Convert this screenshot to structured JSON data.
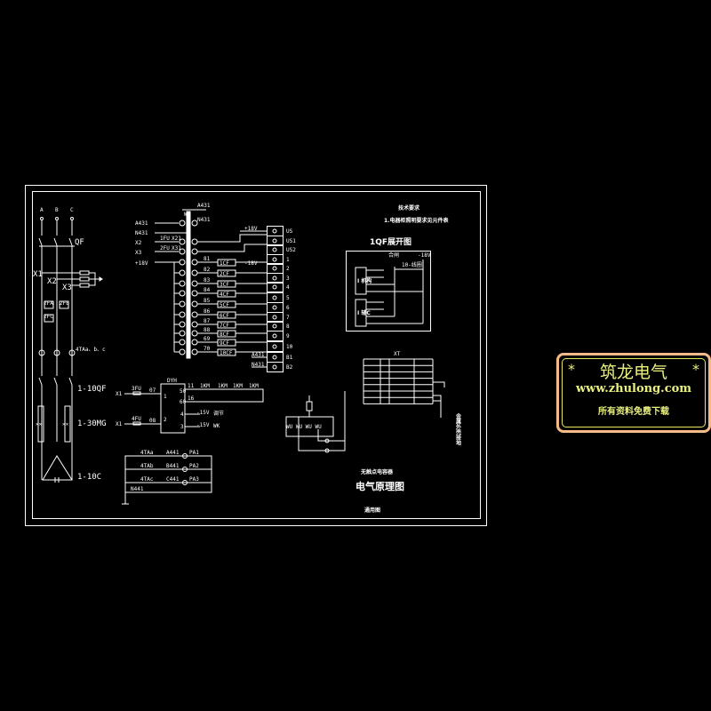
{
  "phases": [
    "A",
    "B",
    "C"
  ],
  "left": {
    "qf": "QF",
    "x1": "X1",
    "x2": "X2",
    "x3": "X3",
    "fa": [
      "2FA",
      "2FB",
      "2FC"
    ],
    "ct": "4TAa、b、c",
    "qf10": "1-10QF",
    "mg": "1-30MG",
    "c10": "1-10C"
  },
  "strip": {
    "top": "A431",
    "wk": "WK",
    "in": [
      "A431",
      "N431",
      "X2",
      "X3",
      "+18V"
    ],
    "n431": "N431",
    "x21": [
      "X21",
      "X31"
    ],
    "fu": [
      "1FU",
      "2FU"
    ],
    "plus18": "+18V",
    "minus18": "-18V",
    "wires": [
      "81",
      "82",
      "83",
      "84",
      "85",
      "86",
      "87",
      "88",
      "69",
      "70"
    ],
    "cf": [
      "1CF",
      "2CF",
      "3CF",
      "4CF",
      "5CF",
      "6CF",
      "7CF",
      "8CF",
      "9CF",
      "10CF"
    ]
  },
  "terminal": {
    "labels": [
      "US",
      "US1",
      "US2",
      "1",
      "2",
      "3",
      "4",
      "5",
      "6",
      "7",
      "8",
      "9",
      "10",
      "B1",
      "B2"
    ],
    "a431": "A431",
    "n431": "N431"
  },
  "dyh": {
    "title": "DYH",
    "x1": "X1",
    "fu3": "3FU",
    "fu4": "4FU",
    "w07": "07",
    "w08": "08",
    "p1": "1",
    "p2": "2",
    "p50": "50",
    "p60": "60",
    "p4": "4",
    "p3": "3",
    "n11": "11",
    "n16": "16",
    "m15a": "-15V",
    "m15b": "-15V",
    "wk": "WK",
    "sig": "调节",
    "k": [
      "1KM",
      "1KM",
      "1KM",
      "1KM"
    ]
  },
  "ammeter": {
    "ta": [
      "4TAa",
      "4TAb",
      "4TAc"
    ],
    "wires": [
      "A441",
      "B441",
      "C441"
    ],
    "pa": [
      "PA1",
      "PA2",
      "PA3"
    ],
    "n441": "N441"
  },
  "notes": {
    "title": "技术要求",
    "line1": "1.电器柜照明要求见元件表",
    "qf_title": "1QF展开图",
    "qf_top": [
      "合闸",
      "-18V"
    ],
    "qf_mid": "10-线圈",
    "qf_lbl": [
      "I 机构",
      "I 辅C"
    ]
  },
  "xt": {
    "title": "XT"
  },
  "side": "金属外壳接地",
  "titleblock": {
    "sub": "无触点电容器",
    "main": "电气原理图",
    "foot": "通用图"
  },
  "watermark": {
    "brand": "筑龙电气",
    "star": "*",
    "url": "www.zhulong.com",
    "slogan": "所有资料免费下载",
    "border": "#f6b98a",
    "text": "#e9f07f"
  }
}
